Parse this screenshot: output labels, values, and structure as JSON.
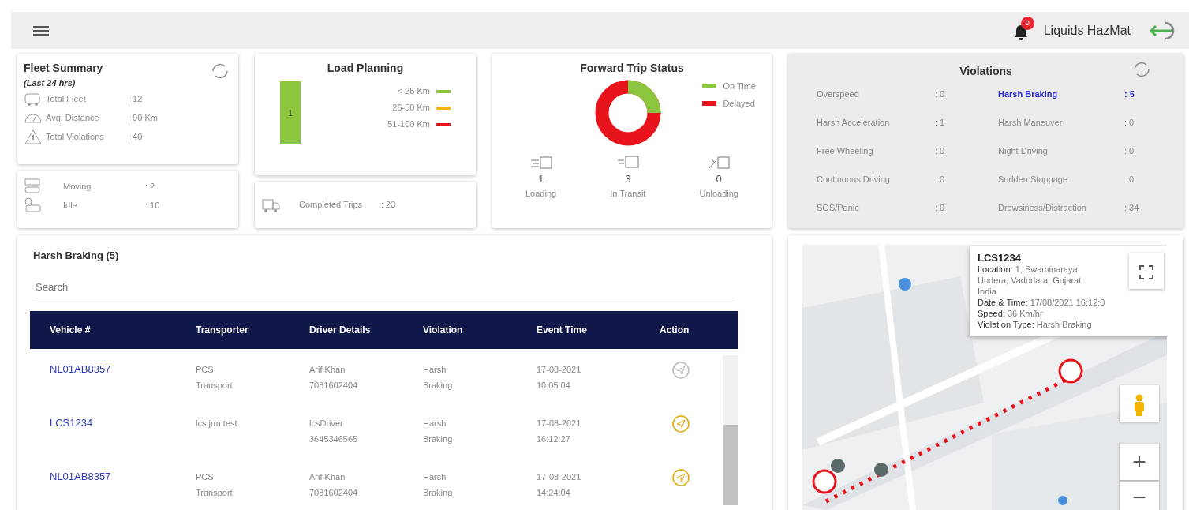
{
  "header": {
    "notification_count": "0",
    "user": "Liquids HazMat"
  },
  "fleet_summary": {
    "title": "Fleet Summary",
    "subtitle": "(Last 24 hrs)",
    "stats": [
      {
        "kind": "fleet",
        "label": "Total Fleet",
        "value": ": 12"
      },
      {
        "kind": "distance",
        "label": "Avg. Distance",
        "value": ": 90 Km"
      },
      {
        "kind": "warning",
        "label": "Total Violations",
        "value": ": 40"
      }
    ],
    "status": [
      {
        "kind": "moving",
        "label": "Moving",
        "value": ": 2"
      },
      {
        "kind": "idle",
        "label": "Idle",
        "value": ": 10"
      }
    ]
  },
  "load_planning": {
    "title": "Load Planning",
    "bar": {
      "label": "1",
      "color": "#8cc63f"
    },
    "legend": [
      {
        "label": "< 25 Km",
        "color": "#8cc63f"
      },
      {
        "label": "26-50 Km",
        "color": "#f7b500"
      },
      {
        "label": "51-100 Km",
        "color": "#e8141b"
      }
    ],
    "completed": {
      "label": "Completed Trips",
      "value": ": 23"
    }
  },
  "trip_status": {
    "title": "Forward Trip Status",
    "legend": [
      {
        "label": "On Time",
        "color": "#8cc63f"
      },
      {
        "label": "Delayed",
        "color": "#e8141b"
      }
    ],
    "stages": [
      {
        "kind": "loading",
        "count": "1",
        "label": "Loading"
      },
      {
        "kind": "transit",
        "count": "3",
        "label": "In Transit"
      },
      {
        "kind": "unloading",
        "count": "0",
        "label": "Unloading"
      }
    ]
  },
  "violations": {
    "title": "Violations",
    "items": [
      {
        "label": "Overspeed",
        "value": ": 0",
        "selected": false
      },
      {
        "label": "Harsh Braking",
        "value": ": 5",
        "selected": true
      },
      {
        "label": "Harsh Acceleration",
        "value": ": 1",
        "selected": false
      },
      {
        "label": "Harsh Maneuver",
        "value": ": 0",
        "selected": false
      },
      {
        "label": "Free Wheeling",
        "value": ": 0",
        "selected": false
      },
      {
        "label": "Night Driving",
        "value": ": 0",
        "selected": false
      },
      {
        "label": "Continuous Driving",
        "value": ": 0",
        "selected": false
      },
      {
        "label": "Sudden Stoppage",
        "value": ": 0",
        "selected": false
      },
      {
        "label": "SOS/Panic",
        "value": ": 0",
        "selected": false
      },
      {
        "label": "Drowsiness/Distraction",
        "value": ": 34",
        "selected": false
      }
    ]
  },
  "list": {
    "title": "Harsh Braking (5)",
    "search": {
      "placeholder": "Search"
    },
    "columns": [
      "Vehicle #",
      "Transporter",
      "Driver Details",
      "Violation",
      "Event Time",
      "Action"
    ],
    "rows": [
      {
        "vehicle": "NL01AB8357",
        "transporter": [
          "PCS",
          "Transport"
        ],
        "driver": [
          "Arif Khan",
          "7081602404"
        ],
        "violation": [
          "Harsh",
          "Braking"
        ],
        "time": [
          "17-08-2021",
          "10:05:04"
        ],
        "action_enabled": false
      },
      {
        "vehicle": "LCS1234",
        "transporter": [
          "lcs jrm test"
        ],
        "driver": [
          "lcsDriver",
          "3645346565"
        ],
        "violation": [
          "Harsh",
          "Braking"
        ],
        "time": [
          "17-08-2021",
          "16:12:27"
        ],
        "action_enabled": true
      },
      {
        "vehicle": "NL01AB8357",
        "transporter": [
          "PCS",
          "Transport"
        ],
        "driver": [
          "Arif Khan",
          "7081602404"
        ],
        "violation": [
          "Harsh",
          "Braking"
        ],
        "time": [
          "17-08-2021",
          "14:24:04"
        ],
        "action_enabled": true
      }
    ]
  },
  "map": {
    "kind": "picture",
    "popup": {
      "title": "LCS1234",
      "lines": [
        "**Location:** 1, Swaminaraya",
        "Undera, Vadodara, Gujarat",
        "India",
        "**Date & Time:** 17/08/2021 16:12:0",
        "**Speed:** 36 Km/hr",
        "**Violation Type:** Harsh Braking"
      ]
    },
    "zoom_in": "+",
    "zoom_out": "−"
  }
}
